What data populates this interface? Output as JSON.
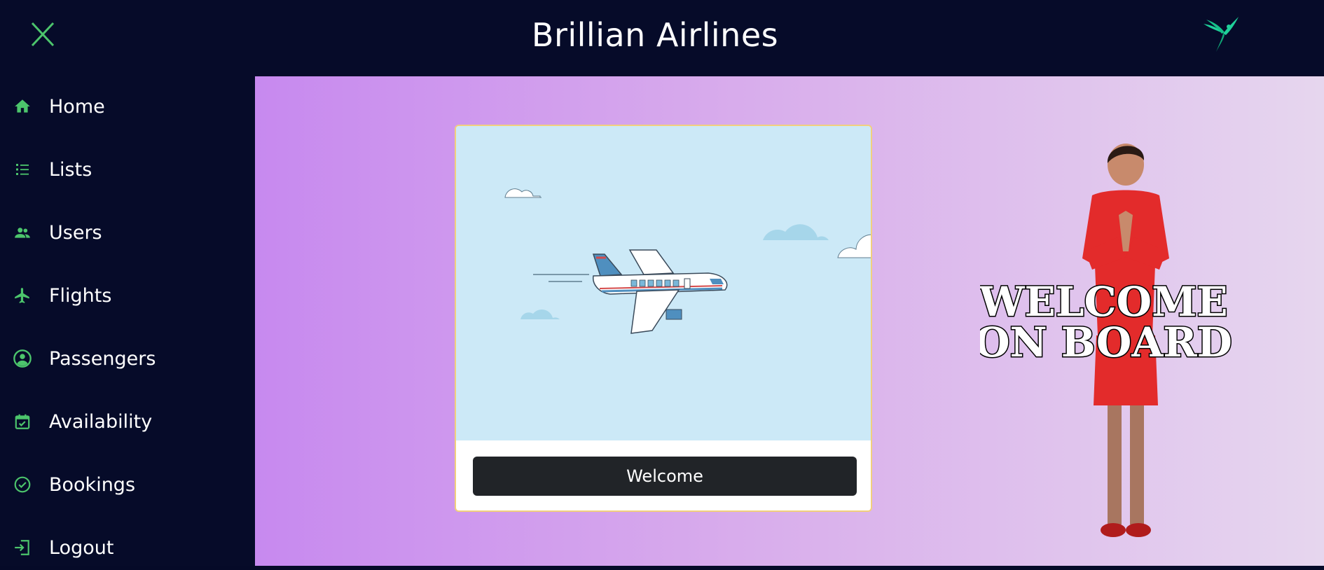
{
  "header": {
    "title": "Brillian Airlines",
    "close_icon": "close-icon",
    "logo_icon": "hummingbird-logo-icon"
  },
  "sidebar": {
    "items": [
      {
        "label": "Home",
        "icon": "home-icon"
      },
      {
        "label": "Lists",
        "icon": "list-icon"
      },
      {
        "label": "Users",
        "icon": "users-icon"
      },
      {
        "label": "Flights",
        "icon": "airplane-icon"
      },
      {
        "label": "Passengers",
        "icon": "account-circle-icon"
      },
      {
        "label": "Availability",
        "icon": "calendar-check-icon"
      },
      {
        "label": "Bookings",
        "icon": "check-circle-icon"
      },
      {
        "label": "Logout",
        "icon": "logout-icon"
      }
    ]
  },
  "card": {
    "illustration": "airplane-flying-illustration",
    "button_label": "Welcome"
  },
  "banner": {
    "line1": "WELCOME",
    "line2": "ON BOARD"
  },
  "colors": {
    "accent": "#4cc56c",
    "topbar": "#060b29",
    "button": "#212428",
    "card_border": "#f1cf7d"
  }
}
